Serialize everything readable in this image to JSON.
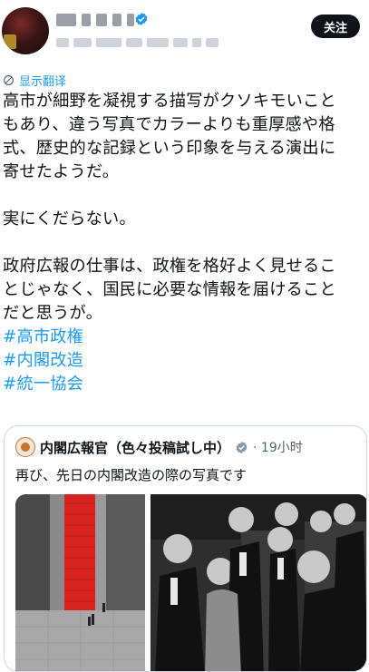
{
  "header": {
    "follow_label": "关注"
  },
  "translate": {
    "label": "显示翻译"
  },
  "post": {
    "lines": [
      "高市が細野を凝視する描写がクソキモいこと",
      "もあり、違う写真でカラーよりも重厚感や格",
      "式、歴史的な記録という印象を与える演出に",
      "寄せたようだ。"
    ],
    "line2": "実にくだらない。",
    "lines3": [
      "政府広報の仕事は、政権を格好よく見せるこ",
      "とじゃなく、国民に必要な情報を届けること",
      "だと思うが。"
    ],
    "hashtags": [
      "#高市政権",
      "#内閣改造",
      "#統一協会"
    ]
  },
  "quote": {
    "name": "内閣広報官（色々投稿試し中）",
    "time": "· 19小时",
    "text": "再び、先日の内閣改造の際の写真です"
  },
  "colors": {
    "accent": "#1d9bf0",
    "text": "#0f1419",
    "muted": "#536471"
  },
  "icons": [
    "verified-badge-icon",
    "translate-icon",
    "gray-check-icon"
  ]
}
